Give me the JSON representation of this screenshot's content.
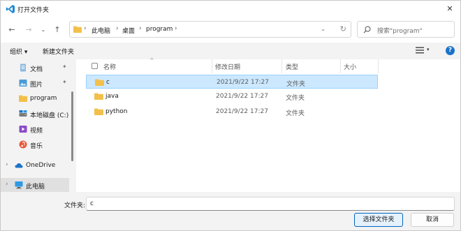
{
  "window": {
    "title": "打开文件夹",
    "close_glyph": "✕"
  },
  "nav": {
    "back": "←",
    "forward": "→",
    "recent": "⌄",
    "up": "↑",
    "breadcrumbs": [
      "此电脑",
      "桌面",
      "program"
    ],
    "separator": "›",
    "dropdown": "⌄",
    "refresh": "↻"
  },
  "search": {
    "placeholder": "搜索\"program\""
  },
  "toolbar": {
    "organize": "组织 ▾",
    "new_folder": "新建文件夹",
    "view_dropdown": "▾",
    "help": "?"
  },
  "sidebar": {
    "items": [
      {
        "label": "文档",
        "icon": "document-icon",
        "pinned": true
      },
      {
        "label": "图片",
        "icon": "image-icon",
        "pinned": true
      },
      {
        "label": "program",
        "icon": "folder-icon",
        "pinned": false
      },
      {
        "label": "本地磁盘 (C:)",
        "icon": "drive-icon",
        "pinned": false
      },
      {
        "label": "视频",
        "icon": "video-icon",
        "pinned": false
      },
      {
        "label": "音乐",
        "icon": "music-icon",
        "pinned": false
      },
      {
        "label": "OneDrive",
        "icon": "cloud-icon",
        "pinned": false
      },
      {
        "label": "此电脑",
        "icon": "computer-icon",
        "pinned": false
      }
    ],
    "pin_glyph": "✦",
    "chevron": "›"
  },
  "columns": {
    "name": "名称",
    "modified": "修改日期",
    "type": "类型",
    "size": "大小",
    "sort_indicator": "^"
  },
  "files": [
    {
      "name": "c",
      "modified": "2021/9/22 17:27",
      "type": "文件夹",
      "selected": true
    },
    {
      "name": "java",
      "modified": "2021/9/22 17:27",
      "type": "文件夹",
      "selected": false
    },
    {
      "name": "python",
      "modified": "2021/9/22 17:27",
      "type": "文件夹",
      "selected": false
    }
  ],
  "footer": {
    "folder_label": "文件夹:",
    "folder_value": "c",
    "select_button": "选择文件夹",
    "cancel_button": "取消"
  },
  "colors": {
    "accent": "#0067c0",
    "selection": "#cce8ff",
    "folder": "#f2c04a"
  }
}
